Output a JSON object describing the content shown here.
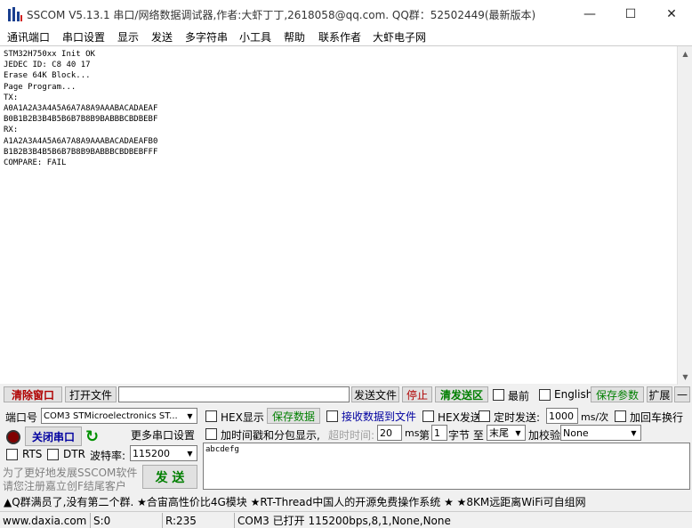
{
  "window": {
    "title": "SSCOM V5.13.1 串口/网络数据调试器,作者:大虾丁丁,2618058@qq.com. QQ群：52502449(最新版本)",
    "minimize": "—",
    "maximize": "☐",
    "close": "✕"
  },
  "menu": [
    "通讯端口",
    "串口设置",
    "显示",
    "发送",
    "多字符串",
    "小工具",
    "帮助",
    "联系作者",
    "大虾电子网"
  ],
  "receive": {
    "lines": "STM32H750xx Init OK\nJEDEC ID: C8 40 17\nErase 64K Block...\nPage Program...\nTX:\nA0A1A2A3A4A5A6A7A8A9AAABACADAEAF\nB0B1B2B3B4B5B6B7B8B9BABBBCBDBEBF\nRX:\nA1A2A3A4A5A6A7A8A9AAABACADAEAFB0\nB1B2B3B4B5B6B7B8B9BABBBCBDBEBFFF\nCOMPARE: FAIL"
  },
  "toolbar1": {
    "clear_window": "清除窗口",
    "open_file": "打开文件",
    "file_path": "",
    "send_file": "发送文件",
    "stop": "停止",
    "clear_send": "清发送区",
    "top_label": "最前",
    "english_label": "English",
    "save_params": "保存参数",
    "expand": "扩展",
    "collapse": "—"
  },
  "port": {
    "port_label": "端口号",
    "port_value": "COM3 STMicroelectronics ST...",
    "close_port": "关闭串口",
    "more_settings": "更多串口设置",
    "rts": "RTS",
    "dtr": "DTR",
    "baud_label": "波特率:",
    "baud_value": "115200"
  },
  "options": {
    "hex_display": "HEX显示",
    "save_data": "保存数据",
    "recv_to_file": "接收数据到文件",
    "hex_send": "HEX发送",
    "timed_send": "定时发送:",
    "interval": "1000",
    "interval_unit": "ms/次",
    "add_crlf": "加回车换行",
    "timestamp": "加时间戳和分包显示,",
    "timeout_label": "超时时间:",
    "timeout_value": "20",
    "timeout_unit": "ms",
    "seg_label": "第",
    "seg_value": "1",
    "byte_label": "字节 至",
    "end_value": "末尾",
    "checksum_label": "加校验",
    "checksum_value": "None"
  },
  "send": {
    "text": "abcdefg",
    "send_button": "发 送",
    "promo_line1": "为了更好地发展SSCOM软件",
    "promo_line2": "请您注册嘉立创F结尾客户"
  },
  "ticker": "▲Q群满员了,没有第二个群. ★合宙高性价比4G模块 ★RT-Thread中国人的开源免费操作系统 ★ ★8KM远距离WiFi可自组网",
  "status": {
    "website": "www.daxia.com",
    "sent": "S:0",
    "received": "R:235",
    "port_info": "COM3 已打开  115200bps,8,1,None,None"
  }
}
